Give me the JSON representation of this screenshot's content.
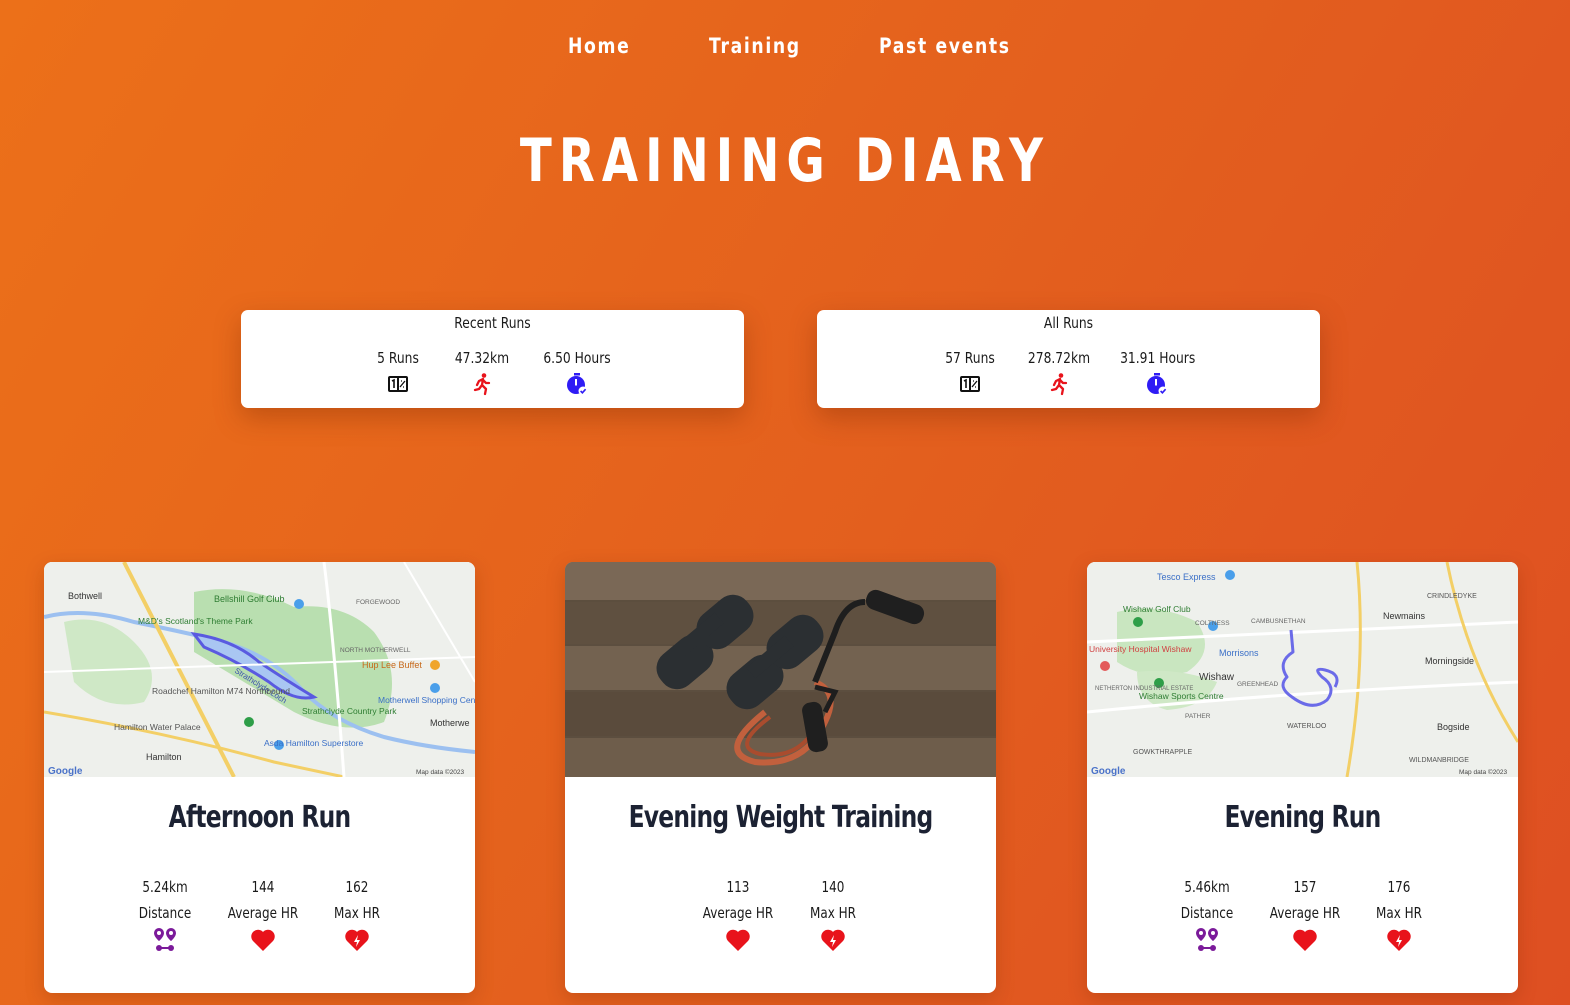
{
  "nav": {
    "links": [
      "Home",
      "Training",
      "Past events"
    ]
  },
  "page_title": "TRAINING DIARY",
  "summaries": [
    {
      "title": "Recent Runs",
      "runs": "5 Runs",
      "distance": "47.32km",
      "time": "6.50 Hours"
    },
    {
      "title": "All Runs",
      "runs": "57 Runs",
      "distance": "278.72km",
      "time": "31.91 Hours"
    }
  ],
  "activities": [
    {
      "title": "Afternoon Run",
      "distance": "5.24km",
      "distance_label": "Distance",
      "avg_hr": "144",
      "avg_hr_label": "Average HR",
      "max_hr": "162",
      "max_hr_label": "Max HR"
    },
    {
      "title": "Evening Weight Training",
      "avg_hr": "113",
      "avg_hr_label": "Average HR",
      "max_hr": "140",
      "max_hr_label": "Max HR"
    },
    {
      "title": "Evening Run",
      "distance": "5.46km",
      "distance_label": "Distance",
      "avg_hr": "157",
      "avg_hr_label": "Average HR",
      "max_hr": "176",
      "max_hr_label": "Max HR"
    }
  ],
  "maps": {
    "map1": {
      "labels": [
        "Bothwell",
        "Bellshill Golf Club",
        "M&D's Scotland's Theme Park",
        "Strathclyde Loch",
        "Roadchef Hamilton M74 Northbound",
        "Hup Lee Buffet",
        "Motherwell Shopping Centre",
        "Strathclyde Country Park",
        "Hamilton Water Palace",
        "Asda Hamilton Superstore",
        "Hamilton",
        "Motherwe",
        "FORGEWOOD",
        "NORTH MOTHERWELL"
      ],
      "attribution": "Map data ©2023",
      "logo": "Google"
    },
    "map2": {
      "labels": [
        "Tesco Express",
        "Wishaw Golf Club",
        "CRINDLEDYKE",
        "Newmains",
        "Morningside",
        "University Hospital Wishaw",
        "Morrisons",
        "Wishaw",
        "Wishaw Sports Centre",
        "GREENHEAD",
        "WATERLOO",
        "Bogside",
        "WILDMANBRIDGE",
        "GOWKTHRAPPLE",
        "PATHER",
        "COLTNESS",
        "CAMBUSNETHAN",
        "NETHERTON INDUSTRIAL ESTATE"
      ],
      "attribution": "Map data ©2023",
      "logo": "Google"
    }
  },
  "icons": {
    "runs": "calendar-count-icon",
    "distance": "running-person-icon",
    "time": "stopwatch-check-icon",
    "route": "route-pins-icon",
    "avg_hr": "heart-icon",
    "max_hr": "heart-bolt-icon"
  },
  "colors": {
    "background_start": "#ec7019",
    "background_end": "#de4f22",
    "card": "#ffffff",
    "accent_red": "#e8131b",
    "accent_blue": "#2f1cf5",
    "accent_purple": "#7b1a9a",
    "title_dark": "#1c2233"
  }
}
